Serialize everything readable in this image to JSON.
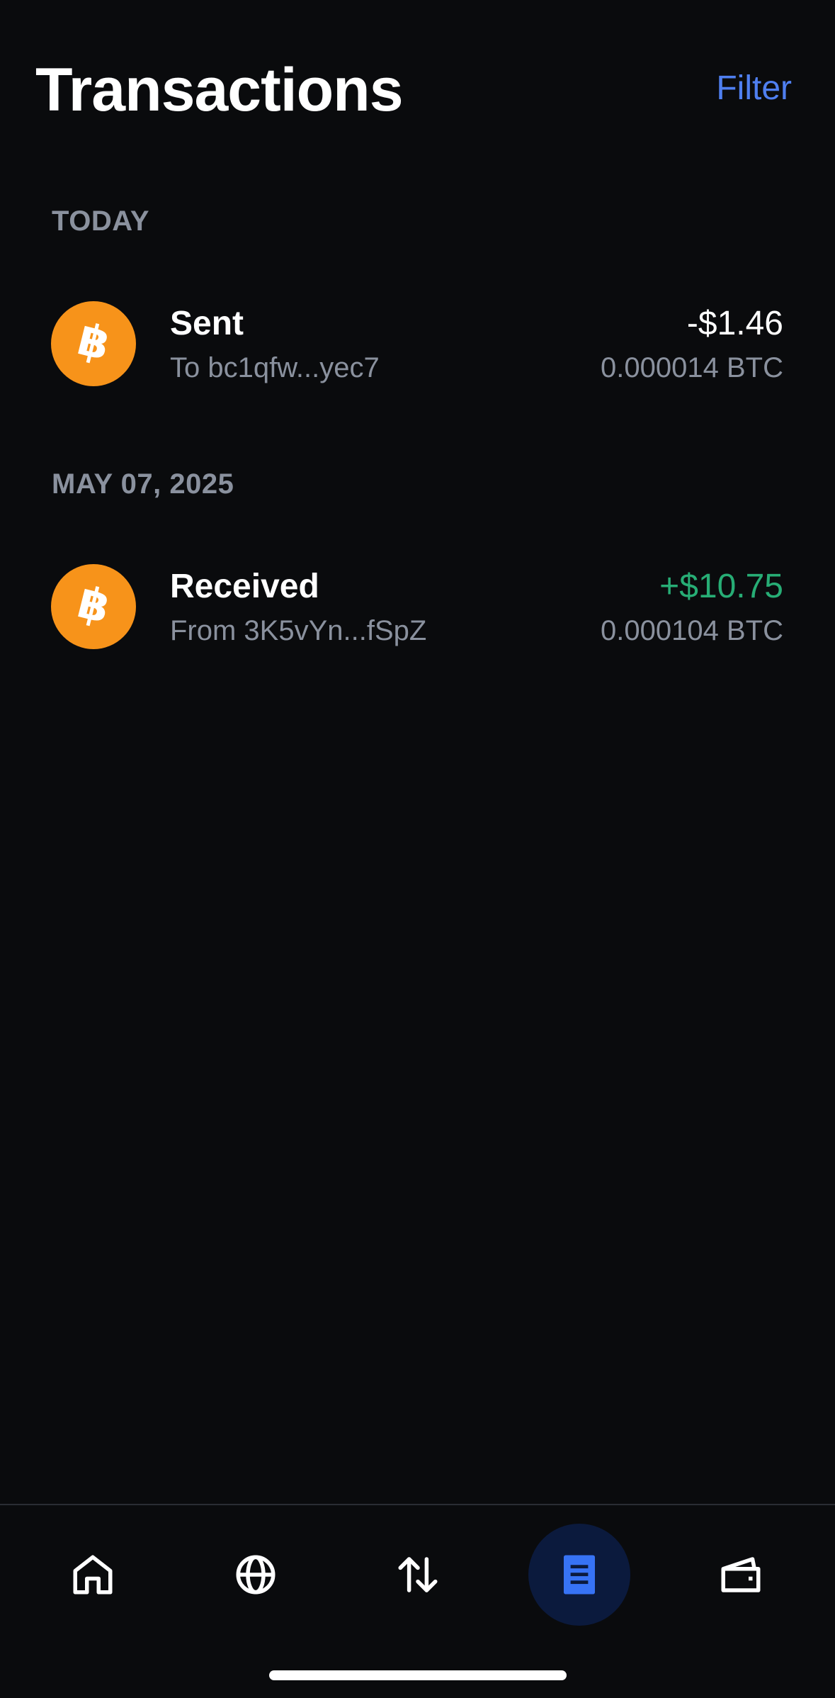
{
  "header": {
    "title": "Transactions",
    "filter_label": "Filter"
  },
  "sections": [
    {
      "label": "TODAY",
      "transactions": [
        {
          "type": "Sent",
          "counterparty": "To bc1qfw...yec7",
          "fiat_amount": "-$1.46",
          "crypto_amount": "0.000014 BTC",
          "asset_icon": "bitcoin-icon"
        }
      ]
    },
    {
      "label": "MAY 07, 2025",
      "transactions": [
        {
          "type": "Received",
          "counterparty": "From 3K5vYn...fSpZ",
          "fiat_amount": "+$10.75",
          "crypto_amount": "0.000104 BTC",
          "asset_icon": "bitcoin-icon"
        }
      ]
    }
  ],
  "nav": {
    "items": [
      {
        "icon": "home-icon",
        "active": false
      },
      {
        "icon": "globe-icon",
        "active": false
      },
      {
        "icon": "swap-arrows-icon",
        "active": false
      },
      {
        "icon": "transactions-list-icon",
        "active": true
      },
      {
        "icon": "wallet-icon",
        "active": false
      }
    ]
  },
  "colors": {
    "background": "#0a0b0d",
    "accent": "#4f7ff0",
    "positive": "#27ad75",
    "muted": "#8a919e",
    "bitcoin": "#f7931a",
    "active_nav_bg": "#0b1a3d",
    "active_nav_icon": "#3773f5"
  }
}
